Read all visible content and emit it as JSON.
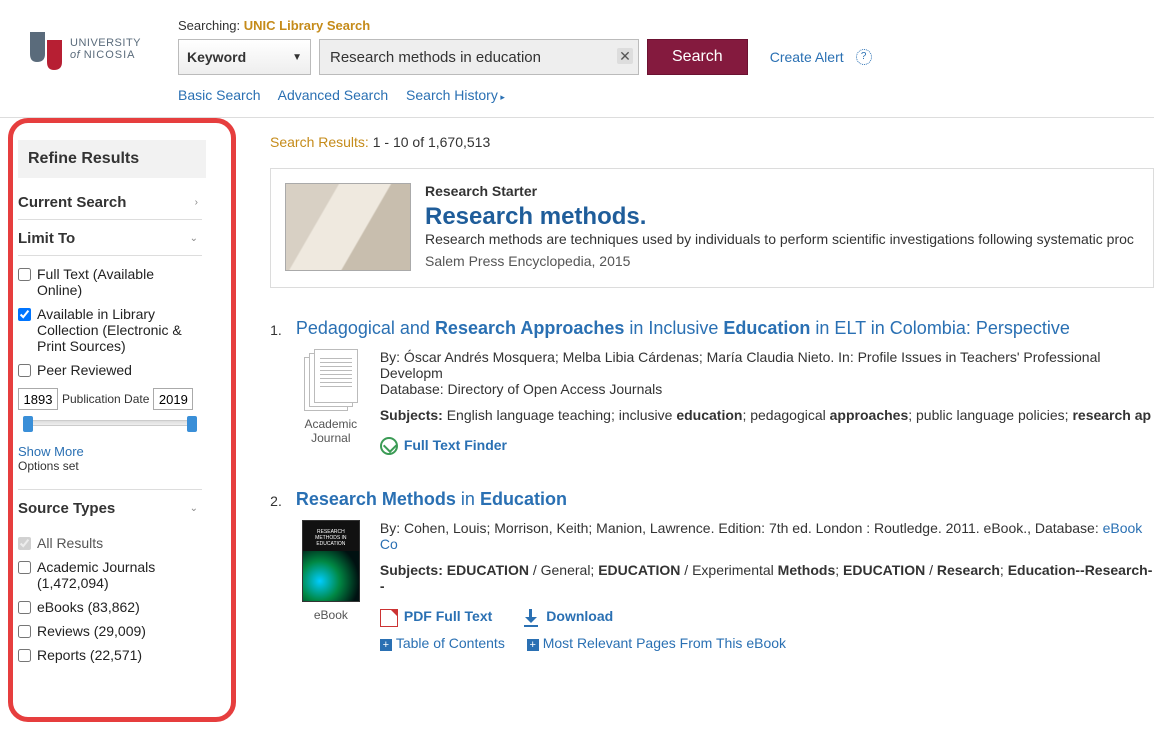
{
  "brand": {
    "name1": "UNIVERSITY",
    "name2": "of NICOSIA"
  },
  "search": {
    "searching_prefix": "Searching:",
    "searching_source": "UNIC Library Search",
    "field_select": "Keyword",
    "query": "Research methods in education",
    "button": "Search",
    "create_alert": "Create Alert",
    "links": {
      "basic": "Basic Search",
      "advanced": "Advanced Search",
      "history": "Search History"
    }
  },
  "refine": {
    "title": "Refine Results",
    "current_search": "Current Search",
    "limit_to": {
      "title": "Limit To",
      "items": [
        {
          "label": "Full Text (Available Online)",
          "checked": false
        },
        {
          "label": "Available in Library Collection (Electronic & Print Sources)",
          "checked": true
        },
        {
          "label": "Peer Reviewed",
          "checked": false
        }
      ],
      "date_from": "1893",
      "date_label": "Publication Date",
      "date_to": "2019",
      "show_more": "Show More",
      "options_set": "Options set"
    },
    "source_types": {
      "title": "Source Types",
      "items": [
        {
          "label": "All Results",
          "checked": true,
          "disabled": true
        },
        {
          "label": "Academic Journals (1,472,094)",
          "checked": false
        },
        {
          "label": "eBooks (83,862)",
          "checked": false
        },
        {
          "label": "Reviews (29,009)",
          "checked": false
        },
        {
          "label": "Reports (22,571)",
          "checked": false
        }
      ]
    }
  },
  "results": {
    "count_label": "Search Results:",
    "count_range": "1 - 10 of 1,670,513",
    "starter": {
      "tag": "Research Starter",
      "title": "Research methods.",
      "desc": "Research methods are techniques used by individuals to perform scientific investigations following systematic proc",
      "source": "Salem Press Encyclopedia, 2015"
    },
    "items": [
      {
        "num": "1.",
        "type": "Academic Journal",
        "title_html": "Pedagogical and <b>Research Approaches</b> in Inclusive <b>Education</b> in ELT in Colombia: Perspective",
        "meta": "By: Óscar Andrés Mosquera; Melba Libia Cárdenas; María Claudia Nieto. In: Profile Issues in Teachers' Professional Developm",
        "meta2": "Database: Directory of Open Access Journals",
        "subjects_html": "<b>Subjects:</b> English language teaching; inclusive <b>education</b>; pedagogical <b>approaches</b>; public language policies; <b>research ap</b>",
        "actions": {
          "ftf": "Full Text Finder"
        }
      },
      {
        "num": "2.",
        "type": "eBook",
        "title_html": "<b>Research Methods</b> in <b>Education</b>",
        "meta_html": "By: Cohen, Louis; Morrison, Keith; Manion, Lawrence. Edition: 7th ed. London : Routledge. 2011. eBook., Database: <a>eBook Co</a>",
        "subjects_html": "<b>Subjects: EDUCATION</b> / General; <b>EDUCATION</b> / Experimental <b>Methods</b>; <b>EDUCATION</b> / <b>Research</b>; <b>Education--Research--</b>",
        "actions": {
          "pdf": "PDF Full Text",
          "download": "Download",
          "toc": "Table of Contents",
          "mrp": "Most Relevant Pages From This eBook"
        }
      }
    ]
  }
}
